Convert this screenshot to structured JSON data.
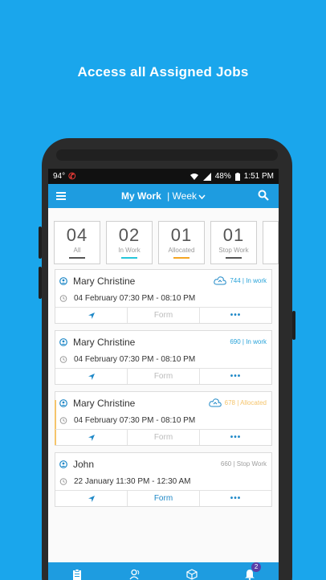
{
  "headline": "Access all Assigned Jobs",
  "status_bar": {
    "temp": "94°",
    "battery": "48%",
    "time": "1:51 PM"
  },
  "app_bar": {
    "title": "My Work",
    "period": "| Week"
  },
  "stats": [
    {
      "count": "04",
      "label": "All",
      "color": "#555555"
    },
    {
      "count": "02",
      "label": "In Work",
      "color": "#26c6da"
    },
    {
      "count": "01",
      "label": "Allocated",
      "color": "#f5a623"
    },
    {
      "count": "01",
      "label": "Stop Work",
      "color": "#555555"
    }
  ],
  "jobs": [
    {
      "name": "Mary Christine",
      "id": "744",
      "status": "| In work",
      "status_color": "#29a3d9",
      "datetime": "04 February 07:30 PM - 08:10 PM",
      "form_label": "Form",
      "form_active": false,
      "cloud": true
    },
    {
      "name": "Mary Christine",
      "id": "690",
      "status": "| In work",
      "status_color": "#29a3d9",
      "datetime": "04 February 07:30 PM - 08:10 PM",
      "form_label": "Form",
      "form_active": false,
      "cloud": false
    },
    {
      "name": "Mary Christine",
      "id": "678",
      "status": "| Allocated",
      "status_color": "#f5c46b",
      "datetime": "04 February 07:30 PM - 08:10 PM",
      "form_label": "Form",
      "form_active": false,
      "cloud": true
    },
    {
      "name": "John",
      "id": "660",
      "status": "| Stop Work",
      "status_color": "#9e9e9e",
      "datetime": "22 January 11:30 PM - 12:30 AM",
      "form_label": "Form",
      "form_active": true,
      "cloud": false
    }
  ],
  "bottom_nav": {
    "notification_count": "2"
  },
  "colors": {
    "background": "#1aa6ec",
    "app_bar": "#1e9ce0",
    "accent": "#1e88c7"
  }
}
